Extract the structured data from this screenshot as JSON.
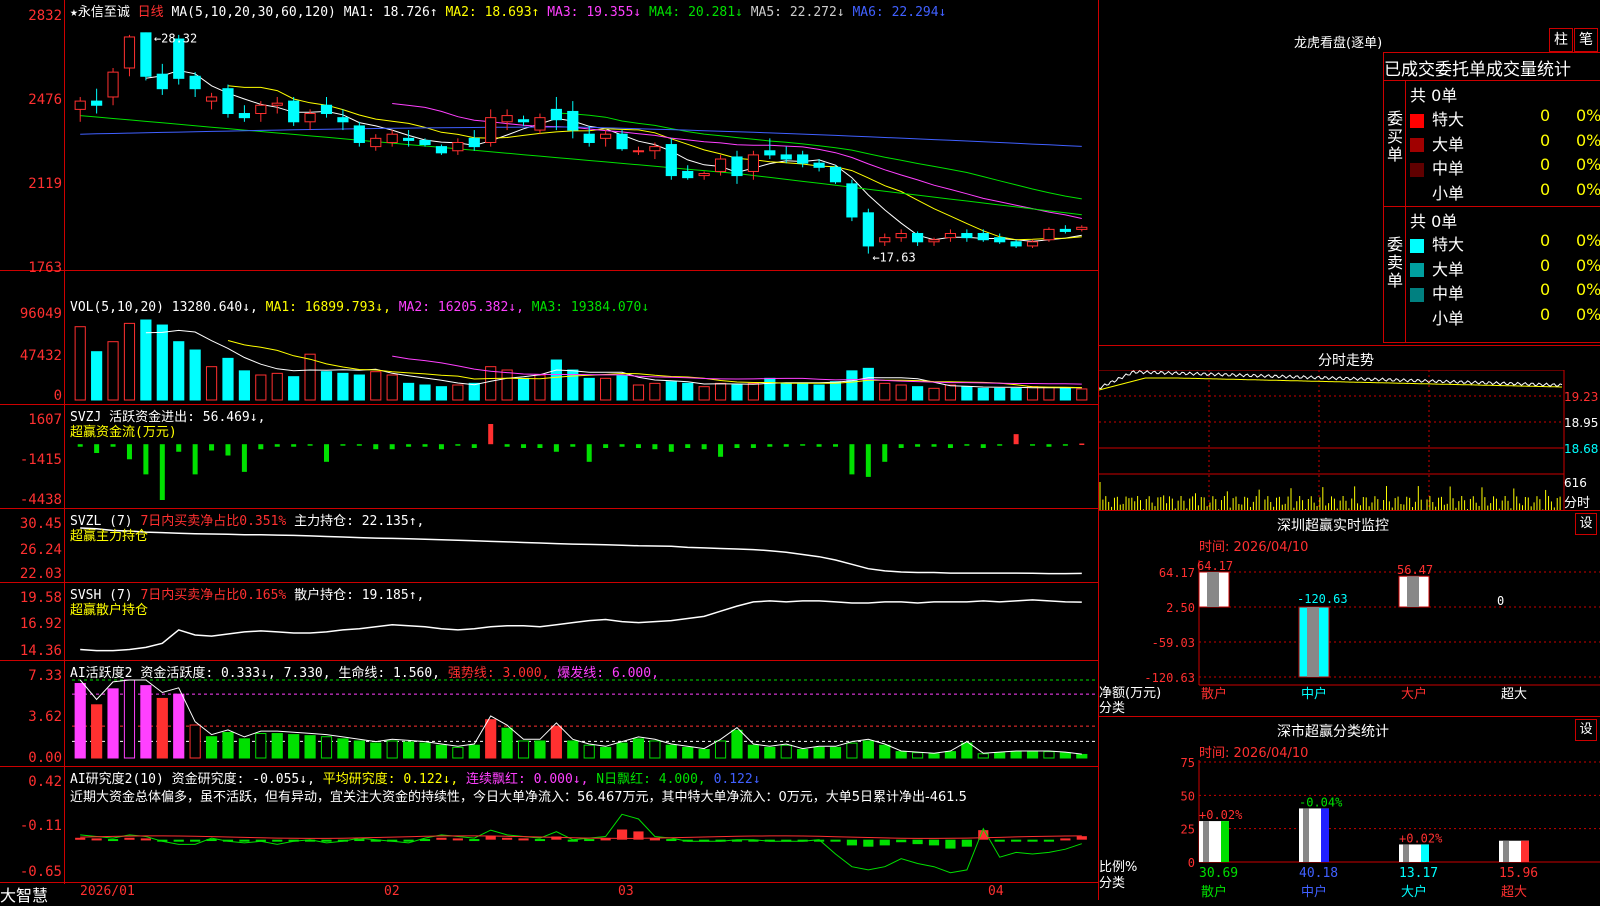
{
  "app": {
    "brand": "大智慧",
    "star_name": "★永信至诚",
    "period": "日线"
  },
  "colors": {
    "up": "#ff3030",
    "down": "#00ffff",
    "ma1": "#ffffff",
    "ma2": "#ffff00",
    "ma3": "#ff40ff",
    "ma4": "#00e000",
    "ma5": "#c0c0c0",
    "ma6": "#4060ff"
  },
  "price": {
    "ma_label": "MA(5,10,20,30,60,120)",
    "mas": [
      "MA1: 18.726↑",
      "MA2: 18.693↑",
      "MA3: 19.355↓",
      "MA4: 20.281↓",
      "MA5: 22.272↓",
      "MA6: 22.294↓"
    ],
    "high_label": "28.32",
    "low_label": "17.63",
    "y_ticks": [
      "2832",
      "2476",
      "2119",
      "1763"
    ]
  },
  "vol": {
    "label": "VOL(5,10,20)",
    "value": "13280.640↓,",
    "mas": [
      "MA1: 16899.793↓,",
      "MA2: 16205.382↓,",
      "MA3: 19384.070↓"
    ],
    "y_ticks": [
      "96049",
      "47432",
      "0"
    ]
  },
  "svzj": {
    "label": "SVZJ",
    "desc": "活跃资金进出: 56.469↓,",
    "sub": "超赢资金流(万元)",
    "y_ticks": [
      "1607",
      "-1415",
      "-4438"
    ]
  },
  "svzl": {
    "label": "SVZL (7)",
    "desc_red": "7日内买卖净占比0.351%",
    "desc": "主力持仓: 22.135↑,",
    "sub": "超赢主力持仓",
    "y_ticks": [
      "30.45",
      "26.24",
      "22.03"
    ]
  },
  "svsh": {
    "label": "SVSH (7)",
    "desc_red": "7日内买卖净占比0.165%",
    "desc": "散户持仓: 19.185↑,",
    "sub": "超赢散户持仓",
    "y_ticks": [
      "19.58",
      "16.92",
      "14.36"
    ]
  },
  "ai1": {
    "label": "AI活跃度2",
    "a": "资金活跃度: 0.333↓,",
    "b": "7.330,",
    "c": "生命线: 1.560,",
    "d": "强势线: 3.000,",
    "e": "爆发线: 6.000,",
    "y_ticks": [
      "7.33",
      "3.62",
      "0.00"
    ]
  },
  "ai2": {
    "label": "AI研究度2(10)",
    "a": "资金研究度: -0.055↓,",
    "b": "平均研究度: 0.122↓,",
    "c": "连续飘红: 0.000↓,",
    "d": "N日飘红: 4.000,",
    "e": "0.122↓",
    "y_ticks": [
      "0.42",
      "-0.11",
      "-0.65"
    ],
    "note": "近期大资金总体偏多，虽不活跃，但有异动，宜关注大资金的持续性，今日大单净流入：56.467万元，其中特大单净流入：0万元，大单5日累计净出-461.5"
  },
  "xaxis": [
    "2026/01",
    "02",
    "03",
    "04"
  ],
  "right": {
    "lh_title": "龙虎看盘(逐单)",
    "btn_zhu": "柱",
    "btn_bi": "笔",
    "stat_title": "已成交委托单成交量统计",
    "buy_side": "委买单",
    "sell_side": "委卖单",
    "buy_total": "共 0单",
    "sell_total": "共 0单",
    "buy_rows": [
      {
        "name": "特大",
        "n": "0",
        "p": "0%",
        "c": "#ff0000"
      },
      {
        "name": "大单",
        "n": "0",
        "p": "0%",
        "c": "#a00000"
      },
      {
        "name": "中单",
        "n": "0",
        "p": "0%",
        "c": "#600000"
      },
      {
        "name": "小单",
        "n": "0",
        "p": "0%",
        "c": "#000000"
      }
    ],
    "sell_rows": [
      {
        "name": "特大",
        "n": "0",
        "p": "0%",
        "c": "#00ffff"
      },
      {
        "name": "大单",
        "n": "0",
        "p": "0%",
        "c": "#00a0a0"
      },
      {
        "name": "中单",
        "n": "0",
        "p": "0%",
        "c": "#008080"
      },
      {
        "name": "小单",
        "n": "0",
        "p": "0%",
        "c": "#000000"
      }
    ],
    "fs_title": "分时走势",
    "fs_y": [
      "19.23",
      "18.95",
      "18.68",
      "616"
    ],
    "fs_unit": "分时",
    "sz_title": "深圳超赢实时监控",
    "set_label": "设",
    "time_label": "时间: 2026/04/10",
    "sz_y": [
      "64.17",
      "2.50",
      "-59.03",
      "-120.63"
    ],
    "sz_values": [
      "64.17",
      "-120.63",
      "56.47",
      "0"
    ],
    "sz_unit": "净额(万元)",
    "fenlei": "分类",
    "cats": [
      "散户",
      "中户",
      "大户",
      "超大"
    ],
    "cls_title": "深市超赢分类统计",
    "cls_y": [
      "75",
      "50",
      "25",
      "0"
    ],
    "cls_top": [
      "+0.02%",
      "-0.04%",
      "+0.02%"
    ],
    "cls_vals": [
      "30.69",
      "40.18",
      "13.17",
      "15.96"
    ],
    "cls_unit": "比例%"
  },
  "chart_data": {
    "type": "candlestick",
    "dates_label": [
      "2026/01",
      "02",
      "03",
      "04"
    ],
    "ohlc": [
      [
        24.6,
        25.2,
        24.0,
        25.0
      ],
      [
        25.0,
        25.6,
        24.4,
        24.8
      ],
      [
        25.2,
        26.6,
        24.8,
        26.4
      ],
      [
        26.6,
        28.2,
        26.2,
        28.1
      ],
      [
        28.3,
        28.32,
        26.0,
        26.2
      ],
      [
        26.3,
        26.8,
        25.3,
        25.6
      ],
      [
        28.0,
        28.2,
        25.8,
        26.1
      ],
      [
        26.2,
        26.4,
        25.2,
        25.6
      ],
      [
        25.0,
        25.4,
        24.6,
        25.2
      ],
      [
        25.6,
        25.8,
        24.2,
        24.4
      ],
      [
        24.4,
        24.8,
        24.0,
        24.2
      ],
      [
        24.4,
        25.0,
        24.0,
        24.8
      ],
      [
        24.8,
        25.2,
        24.4,
        24.9
      ],
      [
        25.0,
        25.2,
        23.8,
        24.0
      ],
      [
        24.0,
        24.6,
        23.6,
        24.4
      ],
      [
        24.8,
        25.2,
        24.2,
        24.4
      ],
      [
        24.2,
        24.6,
        23.6,
        24.0
      ],
      [
        23.8,
        24.0,
        22.8,
        23.0
      ],
      [
        22.8,
        23.4,
        22.6,
        23.2
      ],
      [
        23.0,
        23.6,
        22.8,
        23.4
      ],
      [
        23.2,
        23.6,
        22.8,
        23.1
      ],
      [
        23.1,
        23.2,
        22.8,
        22.9
      ],
      [
        22.8,
        22.9,
        22.4,
        22.5
      ],
      [
        22.6,
        23.2,
        22.4,
        23.0
      ],
      [
        23.2,
        23.6,
        22.6,
        22.8
      ],
      [
        23.0,
        24.6,
        22.8,
        24.2
      ],
      [
        24.0,
        24.6,
        23.6,
        24.3
      ],
      [
        24.1,
        24.3,
        23.8,
        24.0
      ],
      [
        23.6,
        24.4,
        23.4,
        24.2
      ],
      [
        24.6,
        25.2,
        23.6,
        24.1
      ],
      [
        24.5,
        25.0,
        23.2,
        23.6
      ],
      [
        23.4,
        23.8,
        22.8,
        23.0
      ],
      [
        23.2,
        23.6,
        22.8,
        23.4
      ],
      [
        23.4,
        23.6,
        22.6,
        22.7
      ],
      [
        22.6,
        22.8,
        22.4,
        22.6
      ],
      [
        22.6,
        23.0,
        22.2,
        22.8
      ],
      [
        22.9,
        23.2,
        21.2,
        21.4
      ],
      [
        21.6,
        21.9,
        21.2,
        21.3
      ],
      [
        21.4,
        21.6,
        21.2,
        21.5
      ],
      [
        21.6,
        22.4,
        21.4,
        22.2
      ],
      [
        22.3,
        22.6,
        21.0,
        21.4
      ],
      [
        21.6,
        22.6,
        21.2,
        22.4
      ],
      [
        22.6,
        23.2,
        22.2,
        22.4
      ],
      [
        22.4,
        22.8,
        22.0,
        22.2
      ],
      [
        22.4,
        22.6,
        21.8,
        22.0
      ],
      [
        22.0,
        22.2,
        21.6,
        21.8
      ],
      [
        21.8,
        21.9,
        21.0,
        21.1
      ],
      [
        21.0,
        21.2,
        19.2,
        19.4
      ],
      [
        19.6,
        19.8,
        17.63,
        18.0
      ],
      [
        18.2,
        18.6,
        18.0,
        18.4
      ],
      [
        18.4,
        18.8,
        18.2,
        18.6
      ],
      [
        18.6,
        18.7,
        18.0,
        18.2
      ],
      [
        18.2,
        18.4,
        18.0,
        18.3
      ],
      [
        18.4,
        18.8,
        18.2,
        18.6
      ],
      [
        18.6,
        18.8,
        18.2,
        18.4
      ],
      [
        18.6,
        18.8,
        18.2,
        18.3
      ],
      [
        18.4,
        18.6,
        18.1,
        18.2
      ],
      [
        18.2,
        18.3,
        17.9,
        18.0
      ],
      [
        18.0,
        18.3,
        17.9,
        18.2
      ],
      [
        18.3,
        18.9,
        18.2,
        18.8
      ],
      [
        18.8,
        19.0,
        18.6,
        18.7
      ],
      [
        18.8,
        19.0,
        18.7,
        18.9
      ]
    ],
    "volume": [
      88000,
      58000,
      70000,
      92000,
      96049,
      90000,
      70000,
      60000,
      40000,
      50000,
      35000,
      30000,
      32000,
      28000,
      55000,
      34000,
      32000,
      30000,
      34000,
      30000,
      20000,
      18000,
      16000,
      18000,
      20000,
      40000,
      36000,
      26000,
      30000,
      48000,
      36000,
      26000,
      26000,
      30000,
      18000,
      20000,
      22000,
      20000,
      16000,
      20000,
      18000,
      20000,
      26000,
      20000,
      20000,
      18000,
      22000,
      35000,
      38000,
      20000,
      18000,
      16000,
      14000,
      18000,
      16000,
      14000,
      14000,
      14000,
      16000,
      15000,
      15000,
      13280
    ],
    "svzj": [
      -200,
      -700,
      -200,
      -1200,
      -2400,
      -4438,
      -600,
      -2400,
      -500,
      -900,
      -2200,
      -400,
      -200,
      -200,
      -100,
      -1400,
      -100,
      -100,
      -400,
      -400,
      -200,
      -200,
      -400,
      -100,
      -300,
      1607,
      -200,
      -300,
      -300,
      -600,
      -200,
      -1400,
      -300,
      -200,
      -300,
      -400,
      -600,
      -300,
      -400,
      -1000,
      -300,
      -300,
      -200,
      -200,
      -100,
      -200,
      -200,
      -2400,
      -2600,
      -1400,
      -300,
      -200,
      -200,
      -300,
      -100,
      -300,
      -100,
      800,
      -100,
      -200,
      -100,
      56
    ],
    "svzl": [
      30.45,
      30.3,
      30.0,
      29.9,
      29.7,
      29.6,
      29.5,
      29.4,
      29.35,
      29.3,
      29.2,
      29.2,
      29.15,
      29.1,
      29.0,
      28.9,
      28.8,
      28.7,
      28.6,
      28.55,
      28.5,
      28.4,
      28.3,
      28.2,
      28.1,
      28.0,
      27.9,
      27.8,
      27.7,
      27.6,
      27.5,
      27.45,
      27.4,
      27.3,
      27.2,
      27.15,
      27.1,
      26.9,
      26.8,
      26.7,
      26.6,
      26.5,
      26.3,
      26.0,
      25.6,
      25.2,
      24.6,
      23.8,
      23.0,
      22.6,
      22.4,
      22.3,
      22.3,
      22.2,
      22.2,
      22.2,
      22.2,
      22.2,
      22.15,
      22.1,
      22.1,
      22.135
    ],
    "svsh": [
      14.6,
      14.5,
      14.5,
      14.6,
      14.8,
      15.2,
      16.5,
      16.0,
      15.9,
      16.1,
      16.3,
      16.4,
      16.3,
      16.2,
      16.2,
      16.3,
      16.5,
      16.6,
      16.8,
      17.0,
      16.9,
      16.8,
      16.6,
      16.5,
      16.6,
      16.8,
      16.9,
      16.9,
      16.8,
      17.0,
      17.2,
      17.4,
      17.5,
      17.3,
      17.2,
      17.3,
      17.4,
      17.6,
      17.8,
      18.3,
      18.8,
      19.2,
      19.3,
      19.2,
      19.3,
      19.3,
      19.2,
      19.1,
      19.1,
      19.2,
      19.2,
      19.1,
      19.2,
      19.2,
      19.2,
      19.3,
      19.2,
      19.3,
      19.4,
      19.3,
      19.2,
      19.185
    ],
    "ai1": [
      7.0,
      5.0,
      6.5,
      7.33,
      6.8,
      5.6,
      6.0,
      3.1,
      2.0,
      2.4,
      1.8,
      2.3,
      2.3,
      2.2,
      2.1,
      2.0,
      1.8,
      1.6,
      1.4,
      1.6,
      1.5,
      1.4,
      1.2,
      1.0,
      1.2,
      3.6,
      2.8,
      1.6,
      1.6,
      3.0,
      1.6,
      1.2,
      1.0,
      1.4,
      1.8,
      1.6,
      1.2,
      1.0,
      0.8,
      1.6,
      2.6,
      1.2,
      1.0,
      1.2,
      0.8,
      1.0,
      1.0,
      1.4,
      1.6,
      1.2,
      0.6,
      0.5,
      0.4,
      0.6,
      1.4,
      0.4,
      0.5,
      0.6,
      0.6,
      0.6,
      0.5,
      0.333
    ],
    "ai2": [
      -0.08,
      -0.09,
      -0.1,
      -0.08,
      -0.09,
      -0.12,
      -0.14,
      -0.14,
      -0.1,
      -0.12,
      -0.13,
      -0.12,
      -0.14,
      -0.12,
      -0.11,
      -0.13,
      -0.12,
      -0.1,
      -0.11,
      -0.12,
      -0.13,
      -0.1,
      -0.08,
      -0.09,
      -0.1,
      -0.05,
      -0.08,
      -0.09,
      -0.1,
      -0.06,
      -0.11,
      -0.1,
      -0.09,
      0.05,
      0.02,
      -0.09,
      -0.1,
      -0.12,
      -0.12,
      -0.12,
      -0.11,
      -0.11,
      -0.12,
      -0.12,
      -0.12,
      -0.11,
      -0.12,
      -0.2,
      -0.22,
      -0.2,
      -0.15,
      -0.18,
      -0.2,
      -0.25,
      -0.22,
      0.04,
      -0.14,
      -0.11,
      -0.12,
      -0.11,
      -0.09,
      -0.055
    ]
  }
}
